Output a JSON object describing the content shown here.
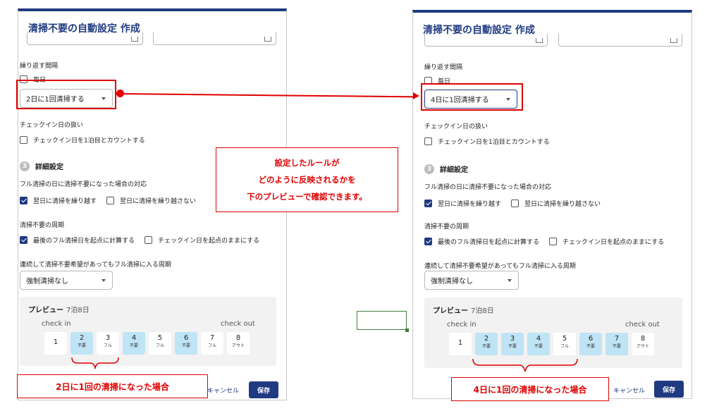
{
  "dialog_title": "清掃不要の自動設定 作成",
  "repeat": {
    "label": "繰り返す間隔",
    "daily_label": "毎日"
  },
  "checkin_handling": {
    "label": "チェックイン日の扱い",
    "count_label": "チェックイン日を1泊目とカウントする"
  },
  "details": {
    "num": "3",
    "label": "詳細設定",
    "full_clean_day_label": "フル清掃の日に清掃不要になった場合の対応",
    "carry_over_label": "翌日に清掃を繰り越す",
    "no_carry_label": "翌日に清掃を繰り越さない",
    "cycle_label": "清掃不要の周期",
    "from_last_full_label": "最後のフル清掃日を起点に計算する",
    "from_checkin_label": "チェックイン日を起点のままにする",
    "forced_cycle_label": "連続して清掃不要希望があってもフル清掃に入る周期",
    "forced_select_value": "強制清掃なし"
  },
  "preview": {
    "title": "プレビュー",
    "info": "7泊8日",
    "check_in": "check in",
    "check_out": "check out"
  },
  "actions": {
    "cancel": "キャンセル",
    "save": "保存"
  },
  "left": {
    "interval_value": "2日に1回清掃する",
    "caption": "2日に1回の清掃になった場合",
    "days": [
      {
        "n": "1",
        "sub": "",
        "style": "white"
      },
      {
        "n": "2",
        "sub": "不要",
        "style": "blue"
      },
      {
        "n": "3",
        "sub": "フル",
        "style": "white"
      },
      {
        "n": "4",
        "sub": "不要",
        "style": "blue"
      },
      {
        "n": "5",
        "sub": "フル",
        "style": "white"
      },
      {
        "n": "6",
        "sub": "不要",
        "style": "blue"
      },
      {
        "n": "7",
        "sub": "フル",
        "style": "white"
      },
      {
        "n": "8",
        "sub": "アウト",
        "style": "white"
      }
    ]
  },
  "right": {
    "interval_value": "4日に1回清掃する",
    "caption": "4日に1回の清掃になった場合",
    "days": [
      {
        "n": "1",
        "sub": "",
        "style": "white"
      },
      {
        "n": "2",
        "sub": "不要",
        "style": "blue"
      },
      {
        "n": "3",
        "sub": "不要",
        "style": "blue"
      },
      {
        "n": "4",
        "sub": "不要",
        "style": "blue"
      },
      {
        "n": "5",
        "sub": "フル",
        "style": "white"
      },
      {
        "n": "6",
        "sub": "不要",
        "style": "blue"
      },
      {
        "n": "7",
        "sub": "不要",
        "style": "blue"
      },
      {
        "n": "8",
        "sub": "アウト",
        "style": "white"
      }
    ]
  },
  "annotation": {
    "line1": "設定したルールが",
    "line2": "どのように反映されるかを",
    "line3": "下のプレビューで確認できます。"
  },
  "colors": {
    "brand": "#1f3a80",
    "highlight_red": "#e00000",
    "day_blue": "#bfe4f5"
  }
}
